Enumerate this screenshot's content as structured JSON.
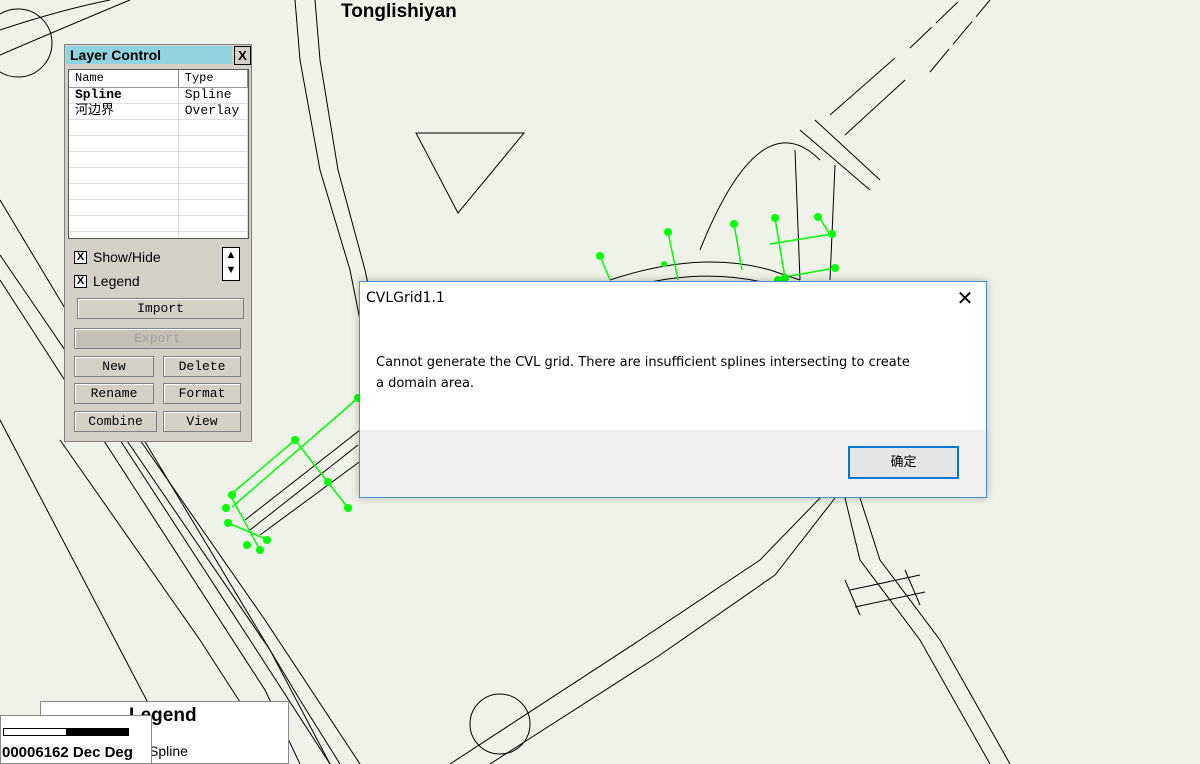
{
  "map": {
    "title": "Tonglishiyan"
  },
  "layer_control": {
    "title": "Layer Control",
    "close": "X",
    "columns": {
      "name": "Name",
      "type": "Type"
    },
    "layers": [
      {
        "name": "Spline",
        "type": "Spline"
      },
      {
        "name": "河边界",
        "type": "Overlay"
      }
    ],
    "show_hide": "Show/Hide",
    "legend": "Legend",
    "check_mark": "X",
    "buttons": {
      "import": "Import",
      "export": "Export",
      "new": "New",
      "delete": "Delete",
      "rename": "Rename",
      "format": "Format",
      "combine": "Combine",
      "view": "View"
    }
  },
  "dialog": {
    "title": "CVLGrid1.1",
    "close": "✕",
    "message_line1": "Cannot generate the CVL grid.  There are insufficient splines intersecting to create",
    "message_line2": "a domain area.",
    "ok": "确定"
  },
  "legend": {
    "title": "Legend",
    "item": "Spline"
  },
  "scale": {
    "text": "00006162 Dec Deg"
  },
  "colors": {
    "map_bg": "#eff2e8",
    "spline": "#00ff00",
    "title_bar": "#8ed3df",
    "dialog_border": "#4a90d9"
  }
}
